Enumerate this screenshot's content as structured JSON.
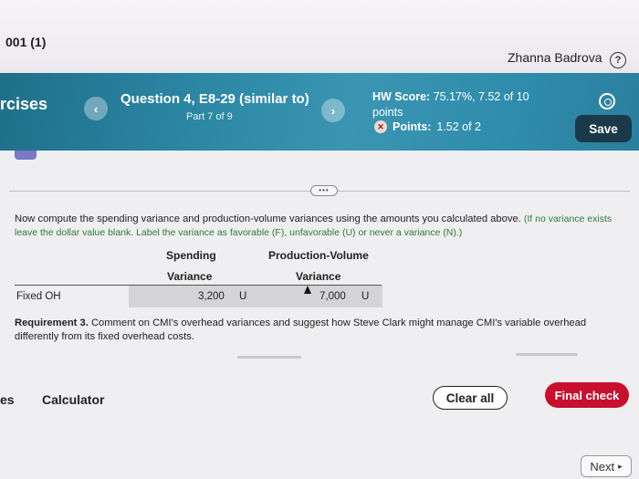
{
  "header": {
    "course_title": "001 (1)",
    "user_name": "Zhanna Badrova",
    "help_icon": "?"
  },
  "question_bar": {
    "section_label": "rcises",
    "prev_icon": "‹",
    "title": "Question 4, E8-29 (similar to)",
    "part": "Part 7 of 9",
    "next_icon": "›",
    "hw_score_label": "HW Score:",
    "hw_score_value": "75.17%, 7.52 of 10",
    "hw_score_suffix": "points",
    "points_label": "Points:",
    "points_value": "1.52 of 2",
    "save_label": "Save"
  },
  "content": {
    "more_label": "•••",
    "instructions_main": "Now compute the spending variance and production-volume variances using the amounts you calculated above.",
    "instructions_note": "(If no variance exists leave the dollar value blank. Label the variance as favorable (F), unfavorable (U) or never a variance (N).)",
    "table": {
      "col1_header_line1": "Spending",
      "col1_header_line2": "Variance",
      "col2_header_line1": "Production-Volume",
      "col2_header_line2": "Variance",
      "row_label": "Fixed OH",
      "spending_amount": "3,200",
      "spending_label": "U",
      "volume_amount": "7,000",
      "volume_label": "U"
    },
    "requirement3_label": "Requirement 3.",
    "requirement3_text": "Comment on CMI's overhead variances and suggest how Steve Clark might manage CMI's variable overhead differently from its fixed overhead costs."
  },
  "footer": {
    "left_fragment": "es",
    "calculator_label": "Calculator",
    "clear_all_label": "Clear all",
    "final_check_label": "Final check",
    "next_label": "Next",
    "next_icon": "▸"
  },
  "colors": {
    "bar_blue": "#2b86a3",
    "save_dark": "#1a3a4a",
    "final_check_red": "#c8102e",
    "note_green": "#2f7a3b"
  }
}
